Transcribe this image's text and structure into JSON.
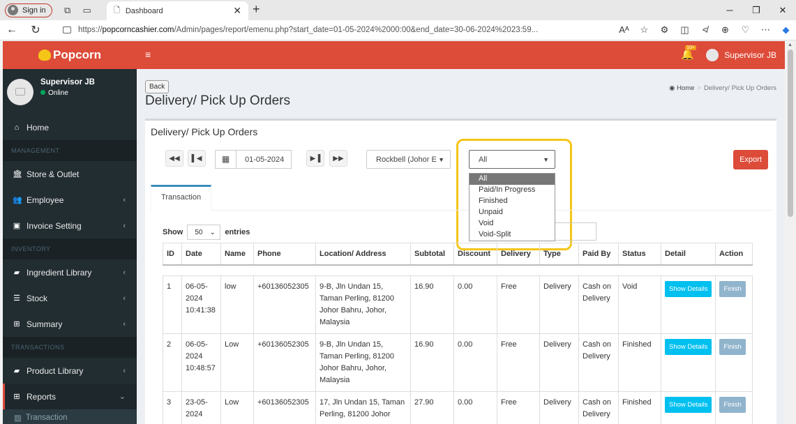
{
  "browser": {
    "signin": "Sign in",
    "tab_title": "Dashboard",
    "url_prefix": "https://",
    "url_domain": "popcorncashier.com",
    "url_rest": "/Admin/pages/report/emenu.php?start_date=01-05-2024%2000:00&end_date=30-06-2024%2023:59...",
    "reading_label": "Aᴬ"
  },
  "sidebar": {
    "logo": "Popcorn",
    "user_name": "Supervisor JB",
    "user_status": "Online",
    "items": [
      {
        "label": "Home",
        "icon": "home-icon"
      },
      {
        "header": "MANAGEMENT"
      },
      {
        "label": "Store & Outlet",
        "icon": "bank-icon"
      },
      {
        "label": "Employee",
        "icon": "users-icon"
      },
      {
        "label": "Invoice Setting",
        "icon": "money-icon"
      },
      {
        "header": "INVENTORY"
      },
      {
        "label": "Ingredient Library",
        "icon": "book-icon"
      },
      {
        "label": "Stock",
        "icon": "database-icon"
      },
      {
        "label": "Summary",
        "icon": "table-icon"
      },
      {
        "header": "TRANSACTIONS"
      },
      {
        "label": "Product Library",
        "icon": "book-icon"
      },
      {
        "label": "Reports",
        "icon": "table-icon"
      },
      {
        "label": "Transaction",
        "icon": "bar-chart-icon"
      }
    ]
  },
  "topnav": {
    "badge": "10+",
    "user_name": "Supervisor JB"
  },
  "content": {
    "back_label": "Back",
    "page_title": "Delivery/ Pick Up Orders",
    "breadcrumb_home": "Home",
    "breadcrumb_current": "Delivery/ Pick Up Orders",
    "box_title": "Delivery/ Pick Up Orders",
    "date_value": "01-05-2024",
    "outlet_value": "Rockbell (Johor E",
    "status_value": "All",
    "status_options": [
      "All",
      "Paid/In Progress",
      "Finished",
      "Unpaid",
      "Void",
      "Void-Split"
    ],
    "export_label": "Export",
    "tab_label": "Transaction",
    "show_label": "Show",
    "show_value": "50",
    "entries_label": "entries"
  },
  "table": {
    "headers": [
      "ID",
      "Date",
      "Name",
      "Phone",
      "Location/ Address",
      "Subtotal",
      "Discount",
      "Delivery",
      "Type",
      "Paid By",
      "Status",
      "Detail",
      "Action"
    ],
    "rows": [
      {
        "id": "1",
        "date": "06-05-2024 10:41:38",
        "name": "low",
        "phone": "+60136052305",
        "address": "9-B, Jln Undan 15, Taman Perling, 81200 Johor Bahru, Johor, Malaysia",
        "subtotal": "16.90",
        "discount": "0.00",
        "delivery": "Free",
        "type": "Delivery",
        "paid_by": "Cash on Delivery",
        "status": "Void",
        "detail": "Show Details",
        "action": "Finish"
      },
      {
        "id": "2",
        "date": "06-05-2024 10:48:57",
        "name": "Low",
        "phone": "+60136052305",
        "address": "9-B, Jln Undan 15, Taman Perling, 81200 Johor Bahru, Johor, Malaysia",
        "subtotal": "16.90",
        "discount": "0.00",
        "delivery": "Free",
        "type": "Delivery",
        "paid_by": "Cash on Delivery",
        "status": "Finished",
        "detail": "Show Details",
        "action": "Finish"
      },
      {
        "id": "3",
        "date": "23-05-2024",
        "name": "Low",
        "phone": "+60136052305",
        "address": "17, Jln Undan 15, Taman Perling, 81200 Johor",
        "subtotal": "27.90",
        "discount": "0.00",
        "delivery": "Free",
        "type": "Delivery",
        "paid_by": "Cash on Delivery",
        "status": "Finished",
        "detail": "Show Details",
        "action": "Finish"
      }
    ]
  },
  "colors": {
    "brand_red": "#dd4b39",
    "sidebar_bg": "#222d32",
    "info_blue": "#00c0ef",
    "highlight_yellow": "#f5c518"
  }
}
